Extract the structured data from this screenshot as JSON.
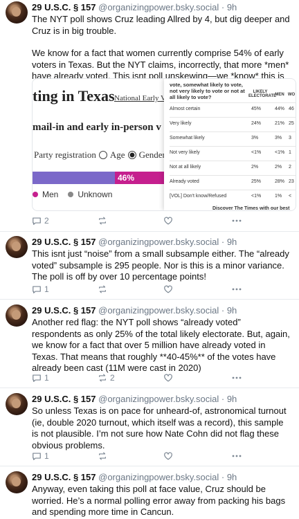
{
  "author": {
    "name": "29 U.S.C. § 157",
    "handle": "@organizingpower.bsky.social",
    "sep": "·",
    "time": "9h"
  },
  "posts": [
    {
      "paragraphs": [
        "The NYT poll shows Cruz leading Allred by 4, but dig deeper and Cruz is in big trouble.",
        "We know for a fact that women currently comprise 54% of early voters in Texas. But the NYT claims, incorrectly, that more *men* have already voted. This isnt poll unskewing—we *know* this is wrong!"
      ],
      "replies": "2",
      "reposts": "",
      "likes": ""
    },
    {
      "paragraphs": [
        "This isnt just “noise” from a small subsample either. The “already voted” subsample is 295 people. Nor is this is a minor variance. The poll is off by over 10 percentage points!"
      ],
      "replies": "1",
      "reposts": "",
      "likes": ""
    },
    {
      "paragraphs": [
        "Another red flag: the NYT poll shows “already voted” respondents as only 25% of the total likely electorate. But, again, we know for a fact that over 5 million have already voted in Texas. That means that roughly **40-45%** of the votes have already been cast (11M were cast in 2020)"
      ],
      "replies": "1",
      "reposts": "2",
      "likes": ""
    },
    {
      "paragraphs": [
        "So unless Texas is on pace for unheard-of, astronomical turnout (ie, double 2020 turnout, which itself was a record), this sample is not plausible. I’m not sure how Nate Cohn did not flag these obvious problems."
      ],
      "replies": "1",
      "reposts": "",
      "likes": ""
    },
    {
      "paragraphs": [
        "Anyway, even taking this poll at face value, Cruz should be worried. He’s a normal polling error away from packing his bags and spending more time in Cancun."
      ]
    }
  ],
  "embed": {
    "title": "ting in Texas",
    "link": "National Early Vo",
    "subtitle": "mail-in and early in-person v",
    "radios": [
      "Party registration",
      "Age",
      "Gender"
    ],
    "selected_radio": "Gender",
    "bar_label": "46%",
    "bar_pink_share": 0.46,
    "legend": [
      "Men",
      "Unknown"
    ],
    "colors": {
      "purple": "#7b68c9",
      "pink": "#c51f8e",
      "unknown": "#888888"
    },
    "table": {
      "question": "vote, somewhat likely to vote, not very likely to vote or not at all likely to vote?",
      "headers": [
        "LIKELY ELECTORATE",
        "MEN",
        "WO"
      ],
      "rows": [
        {
          "label": "Almost certain",
          "le": "45%",
          "men": "44%",
          "wo": "46"
        },
        {
          "label": "Very likely",
          "le": "24%",
          "men": "21%",
          "wo": "25"
        },
        {
          "label": "Somewhat likely",
          "le": "3%",
          "men": "3%",
          "wo": "3"
        },
        {
          "label": "Not very likely",
          "le": "<1%",
          "men": "<1%",
          "wo": "1"
        },
        {
          "label": "Not at all likely",
          "le": "2%",
          "men": "2%",
          "wo": "2"
        },
        {
          "label": "Already voted",
          "le": "25%",
          "men": "28%",
          "wo": "23"
        },
        {
          "label": "[VOL] Don't know/Refused",
          "le": "<1%",
          "men": "1%",
          "wo": "<"
        }
      ],
      "footer": "Discover The Times with our best"
    }
  }
}
